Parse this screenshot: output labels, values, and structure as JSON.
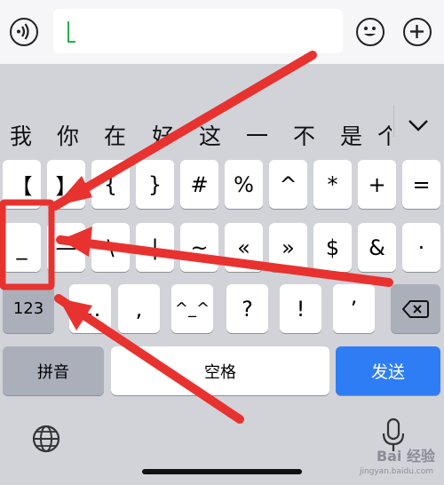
{
  "top_bar": {
    "voice_icon": "voice-icon",
    "emoji_icon": "emoji-icon",
    "plus_icon": "plus-icon"
  },
  "candidates": {
    "words": [
      "我",
      "你",
      "在",
      "好",
      "这",
      "一",
      "不",
      "是",
      "个"
    ],
    "expand_icon": "chevron-down-icon"
  },
  "keyboard": {
    "row1": [
      "【",
      "】",
      "{",
      "}",
      "#",
      "%",
      "^",
      "*",
      "+",
      "="
    ],
    "row2": [
      "_",
      "—",
      "\\",
      "|",
      "~",
      "«",
      "»",
      "$",
      "&",
      "·"
    ],
    "row3_left": "123",
    "row3": [
      "…",
      ",",
      "^_^",
      "?",
      "!",
      "’"
    ],
    "row4": {
      "pinyin": "拼音",
      "space": "空格",
      "send": "发送"
    },
    "globe_icon": "globe-icon",
    "mic_icon": "microphone-icon"
  },
  "watermark": {
    "brand": "Bai 经验",
    "url": "jingyan.baidu.com"
  },
  "colors": {
    "send": "#2f7df5",
    "annotation": "#e8322f",
    "cursor": "#22b14c"
  }
}
